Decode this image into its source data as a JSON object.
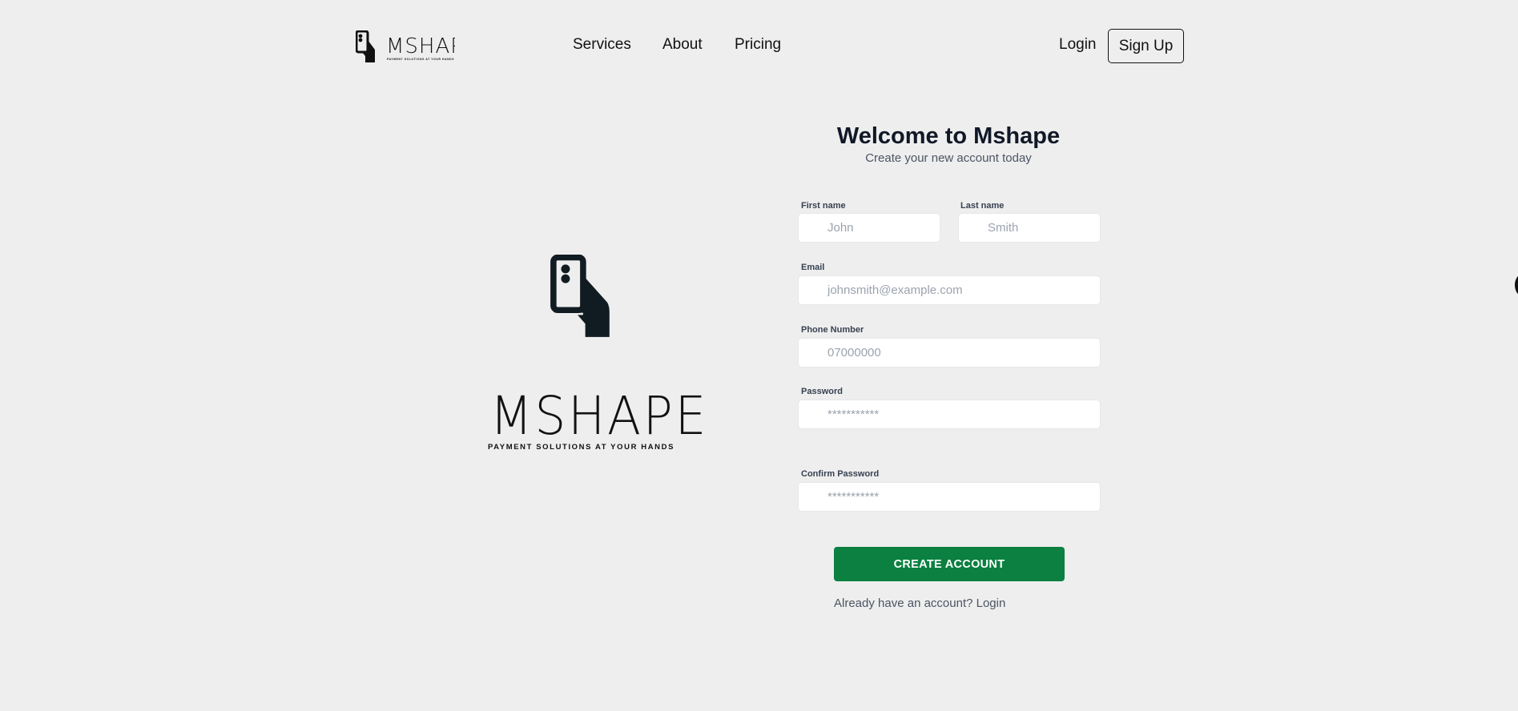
{
  "header": {
    "logo_alt": "Mshape logo",
    "nav": [
      {
        "label": "Services"
      },
      {
        "label": "About"
      },
      {
        "label": "Pricing"
      }
    ],
    "login_label": "Login",
    "signup_label": "Sign Up"
  },
  "brand": {
    "name": "MSHAPE",
    "tagline": "PAYMENT SOLUTIONS AT YOUR HANDS"
  },
  "form": {
    "title": "Welcome to Mshape",
    "subtitle": "Create your new account today",
    "first_name": {
      "label": "First name",
      "placeholder": "John",
      "value": ""
    },
    "last_name": {
      "label": "Last name",
      "placeholder": "Smith",
      "value": ""
    },
    "email": {
      "label": "Email",
      "placeholder": "johnsmith@example.com",
      "value": ""
    },
    "phone": {
      "label": "Phone Number",
      "placeholder": "07000000",
      "value": ""
    },
    "password": {
      "label": "Password",
      "placeholder": "***********",
      "value": ""
    },
    "confirm_password": {
      "label": "Confirm Password",
      "placeholder": "***********",
      "value": ""
    },
    "submit_label": "CREATE ACCOUNT",
    "footer_text": "Already have an account? ",
    "footer_link": "Login"
  },
  "colors": {
    "background": "#eeeeee",
    "primary_button": "#0b8040",
    "text_dark": "#111827",
    "text_muted": "#4b5563"
  }
}
